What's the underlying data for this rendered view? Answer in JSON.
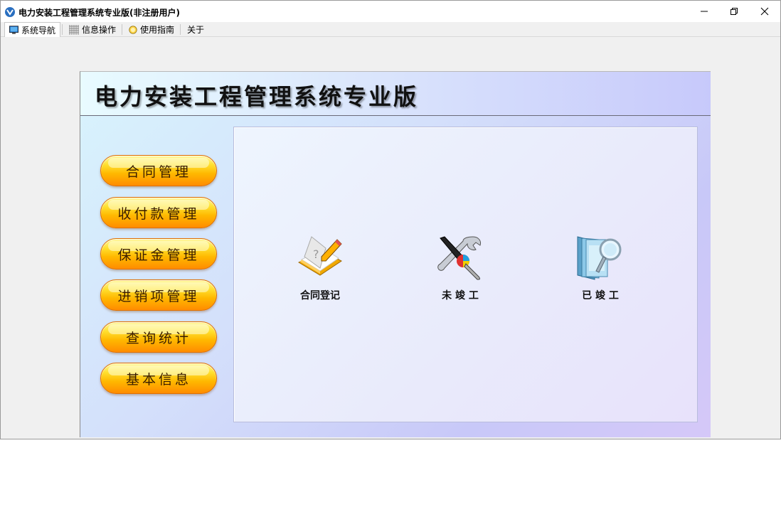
{
  "window": {
    "title": "电力安装工程管理系统专业版(非注册用户)"
  },
  "menu": {
    "items": [
      {
        "label": "系统导航",
        "icon": "monitor-icon"
      },
      {
        "label": "信息操作",
        "icon": "grid-icon"
      },
      {
        "label": "使用指南",
        "icon": "help-circle-icon"
      },
      {
        "label": "关于",
        "icon": ""
      }
    ]
  },
  "banner": {
    "title": "电力安装工程管理系统专业版"
  },
  "nav": {
    "buttons": [
      {
        "label": "合同管理"
      },
      {
        "label": "收付款管理"
      },
      {
        "label": "保证金管理"
      },
      {
        "label": "进销项管理"
      },
      {
        "label": "查询统计"
      },
      {
        "label": "基本信息"
      }
    ]
  },
  "content": {
    "tiles": [
      {
        "label": "合同登记",
        "icon": "notebook-pencil-icon"
      },
      {
        "label": "未 竣 工",
        "icon": "tools-icon"
      },
      {
        "label": "已 竣 工",
        "icon": "folder-search-icon"
      }
    ]
  },
  "colors": {
    "button_top": "#ffe030",
    "button_bottom": "#ff8c00",
    "panel_bg": "#d4e0fb"
  }
}
